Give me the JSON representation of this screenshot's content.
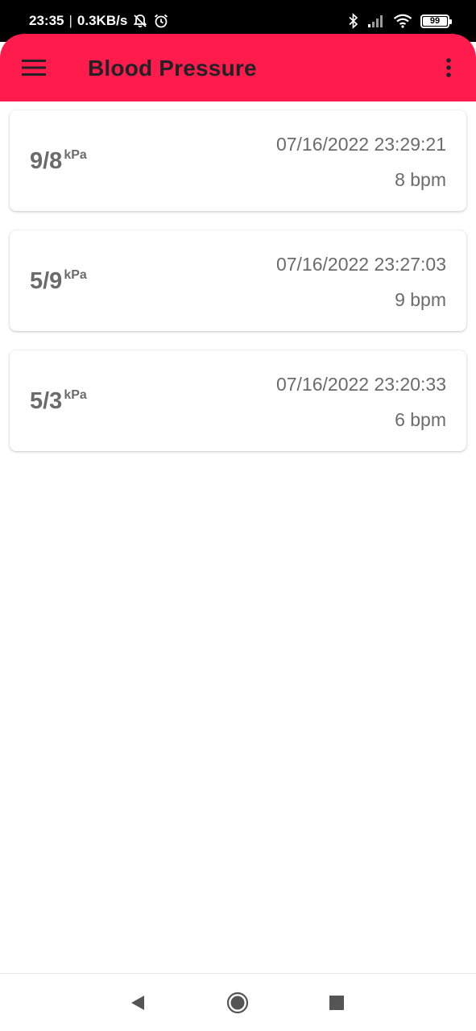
{
  "status_bar": {
    "time": "23:35",
    "separator": "|",
    "net_speed": "0.3KB/s",
    "icons": [
      "mute-notifications-icon",
      "alarm-icon",
      "bluetooth-icon",
      "signal-icon",
      "wifi-icon",
      "battery-icon"
    ],
    "battery_level": "99"
  },
  "app_bar": {
    "title": "Blood Pressure",
    "accent_color": "#ff1b4b",
    "menu_icon": "hamburger-menu-icon",
    "overflow_icon": "more-vertical-icon"
  },
  "records": [
    {
      "pressure": "9/8",
      "unit": "kPa",
      "timestamp": "07/16/2022 23:29:21",
      "heart_rate": "8 bpm"
    },
    {
      "pressure": "5/9",
      "unit": "kPa",
      "timestamp": "07/16/2022 23:27:03",
      "heart_rate": "9 bpm"
    },
    {
      "pressure": "5/3",
      "unit": "kPa",
      "timestamp": "07/16/2022 23:20:33",
      "heart_rate": "6 bpm"
    }
  ],
  "nav_bar": {
    "icons": [
      "back-icon",
      "home-icon",
      "recents-icon"
    ]
  }
}
